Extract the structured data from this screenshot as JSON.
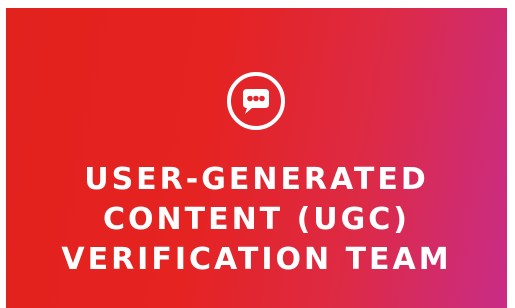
{
  "banner": {
    "icon": "speech-bubble-icon",
    "title_lines": [
      "USER-GENERATED",
      "CONTENT (UGC)",
      "VERIFICATION TEAM"
    ],
    "colors": {
      "gradient_start": "#e2221d",
      "gradient_mid": "#dd2a45",
      "gradient_end": "#c92c86",
      "foreground": "#ffffff"
    }
  }
}
